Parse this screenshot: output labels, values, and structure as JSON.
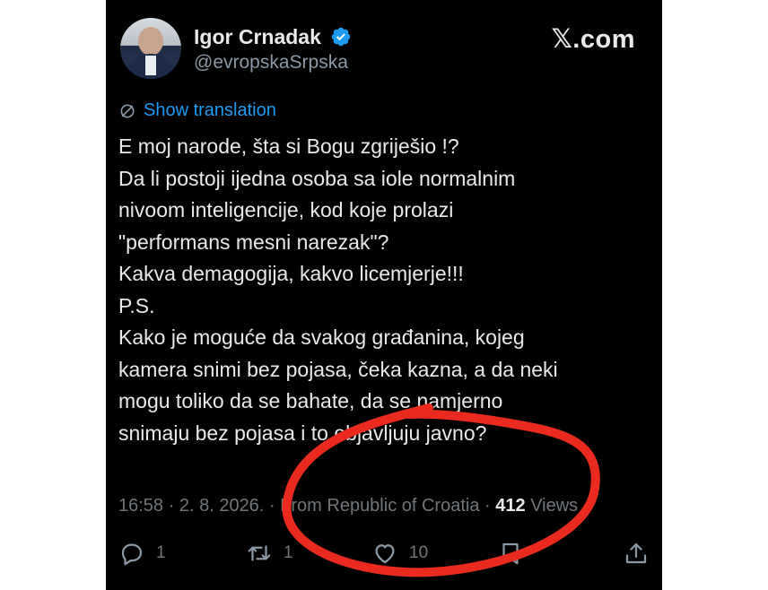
{
  "author": {
    "name": "Igor Crnadak",
    "handle": "@evropskaSrpska",
    "verified": true,
    "avatar_icon": "avatar-photo"
  },
  "platform_watermark": "𝕏.com",
  "translate_link": "Show translation",
  "tweet_lines": [
    "E moj narode, šta si Bogu zgriješio !?",
    "Da li postoji ijedna osoba sa iole normalnim",
    "nivoom inteligencije, kod koje prolazi",
    "\"performans mesni narezak\"?",
    "Kakva demagogija, kakvo licemjerje!!!",
    "P.S.",
    "Kako je moguće da svakog građanina, kojeg",
    "kamera snimi bez pojasa, čeka kazna, a da neki",
    "mogu toliko da se bahate, da se namjerno",
    "snimaju bez pojasa i to objavljuju javno?"
  ],
  "meta": {
    "time": "16:58",
    "date": "2. 8. 2026.",
    "origin": "From Republic of Croatia",
    "views_count": "412",
    "views_label": "Views"
  },
  "actions": {
    "reply_count": "1",
    "retweet_count": "1",
    "like_count": "10"
  },
  "colors": {
    "background": "#000000",
    "text": "#e7e9ea",
    "secondary": "#71767b",
    "link": "#1d9bf0",
    "annotation": "#ea2a1f"
  }
}
